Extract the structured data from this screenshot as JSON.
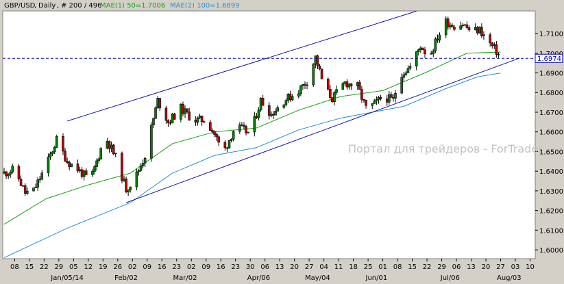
{
  "header": {
    "symbol": "GBP/USD",
    "timeframe": "Daily",
    "bars": "# 200 / 496",
    "mae1": "MAE(1) 50=1.7006",
    "mae2": "MAE(2) 100=1.6899"
  },
  "watermark": "Портал для трейдеров - ForTrader",
  "price_label": "1.6974",
  "colors": {
    "background": "#ffffff",
    "frame": "#d4d0c8",
    "up_candle": "#008000",
    "down_candle": "#c00000",
    "mae1": "#14a014",
    "mae2": "#1e90d0",
    "channel": "#1010b4",
    "price_line": "#0000cc"
  },
  "chart_data": {
    "type": "candlestick",
    "symbol": "GBP/USD",
    "timeframe": "Daily",
    "ylim": [
      1.5955,
      1.7215
    ],
    "yticks": [
      1.6,
      1.61,
      1.62,
      1.63,
      1.64,
      1.65,
      1.66,
      1.67,
      1.68,
      1.69,
      1.7,
      1.71
    ],
    "ytick_labels": [
      "1.6000",
      "1.6100",
      "1.6200",
      "1.6300",
      "1.6400",
      "1.6500",
      "1.6600",
      "1.6700",
      "1.6800",
      "1.6900",
      "1.7000",
      "1.7100"
    ],
    "xlim": [
      0,
      186
    ],
    "xticks": [
      {
        "x": 5,
        "label": "08"
      },
      {
        "x": 12,
        "label": "15"
      },
      {
        "x": 19,
        "label": "22"
      },
      {
        "x": 26,
        "label": "29"
      },
      {
        "x": 33,
        "label": "05"
      },
      {
        "x": 40,
        "label": "12"
      },
      {
        "x": 47,
        "label": "19"
      },
      {
        "x": 54,
        "label": "26"
      },
      {
        "x": 61,
        "label": "02"
      },
      {
        "x": 68,
        "label": "09"
      },
      {
        "x": 75,
        "label": "16"
      },
      {
        "x": 82,
        "label": "23"
      },
      {
        "x": 89,
        "label": "02"
      },
      {
        "x": 96,
        "label": "09"
      },
      {
        "x": 103,
        "label": "16"
      },
      {
        "x": 110,
        "label": "23"
      },
      {
        "x": 117,
        "label": "30"
      },
      {
        "x": 124,
        "label": "06"
      },
      {
        "x": 131,
        "label": "13"
      },
      {
        "x": 138,
        "label": "20"
      },
      {
        "x": 145,
        "label": "27"
      },
      {
        "x": 152,
        "label": "04"
      },
      {
        "x": 159,
        "label": "11"
      },
      {
        "x": 166,
        "label": "18"
      },
      {
        "x": 173,
        "label": "25"
      },
      {
        "x": 180,
        "label": "01"
      },
      {
        "x": 187,
        "label": "08"
      },
      {
        "x": 194,
        "label": "15"
      },
      {
        "x": 201,
        "label": "22"
      },
      {
        "x": 208,
        "label": "29"
      },
      {
        "x": 215,
        "label": "06"
      },
      {
        "x": 222,
        "label": "13"
      },
      {
        "x": 229,
        "label": "20"
      },
      {
        "x": 236,
        "label": "27"
      },
      {
        "x": 243,
        "label": "03"
      },
      {
        "x": 250,
        "label": "10"
      }
    ],
    "month_labels": [
      {
        "x": 30,
        "label": "Jan/05/14"
      },
      {
        "x": 58,
        "label": "Feb/02"
      },
      {
        "x": 86,
        "label": "Mar/02"
      },
      {
        "x": 121,
        "label": "Apr/06"
      },
      {
        "x": 149,
        "label": "May/04"
      },
      {
        "x": 177,
        "label": "Jun/01"
      },
      {
        "x": 212,
        "label": "Jul/06"
      },
      {
        "x": 240,
        "label": "Aug/03"
      }
    ],
    "ohlc": [],
    "last_close": 1.6974,
    "mae1": {
      "name": "MAE(1) 50",
      "last": 1.7006
    },
    "mae2": {
      "name": "MAE(2) 100",
      "last": 1.6899
    },
    "channel_upper": [
      [
        30,
        1.6655
      ],
      [
        196,
        1.7214
      ]
    ],
    "channel_lower": [
      [
        58,
        1.624
      ],
      [
        245,
        1.6975
      ]
    ]
  }
}
